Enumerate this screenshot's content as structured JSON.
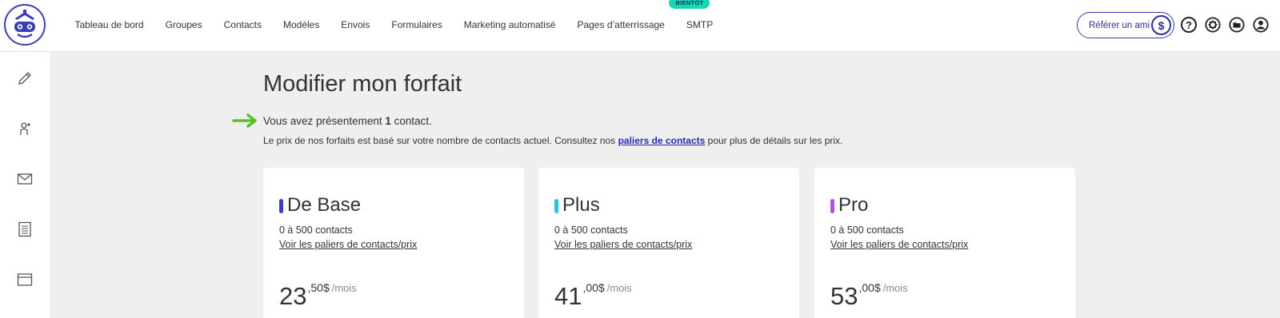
{
  "nav": {
    "items": [
      {
        "label": "Tableau de bord"
      },
      {
        "label": "Groupes"
      },
      {
        "label": "Contacts"
      },
      {
        "label": "Modèles"
      },
      {
        "label": "Envois"
      },
      {
        "label": "Formulaires"
      },
      {
        "label": "Marketing automatisé"
      },
      {
        "label": "Pages d’atterrissage"
      },
      {
        "label": "SMTP",
        "badge": "BIENTÔT"
      }
    ]
  },
  "header": {
    "refer_label": "Référer un ami",
    "refer_icon": "$",
    "help_icon": "?"
  },
  "sidebar": {
    "icons": [
      "pencil-icon",
      "add-contact-icon",
      "envelope-icon",
      "form-icon",
      "landing-page-icon"
    ]
  },
  "main": {
    "title": "Modifier mon forfait",
    "contacts_prefix": "Vous avez présentement",
    "contacts_count": "1",
    "contacts_suffix": "contact.",
    "pricing_prefix": "Le prix de nos forfaits est basé sur votre nombre de contacts actuel. Consultez nos",
    "pricing_link": "paliers de contacts",
    "pricing_suffix": "pour plus de détails sur les prix."
  },
  "plans": [
    {
      "name": "De Base",
      "range": "0 à 500 contacts",
      "link": "Voir les paliers de contacts/prix",
      "price_int": "23",
      "price_dec": ",50$",
      "period": "/mois",
      "color": "#3b3fc8"
    },
    {
      "name": "Plus",
      "range": "0 à 500 contacts",
      "link": "Voir les paliers de contacts/prix",
      "price_int": "41",
      "price_dec": ",00$",
      "period": "/mois",
      "color": "#22c4e6"
    },
    {
      "name": "Pro",
      "range": "0 à 500 contacts",
      "link": "Voir les paliers de contacts/prix",
      "price_int": "53",
      "price_dec": ",00$",
      "period": "/mois",
      "color": "#b44fd9"
    }
  ],
  "colors": {
    "accent": "#2e2ea0",
    "badge": "#16d6b5",
    "arrow": "#5bbf2a"
  }
}
